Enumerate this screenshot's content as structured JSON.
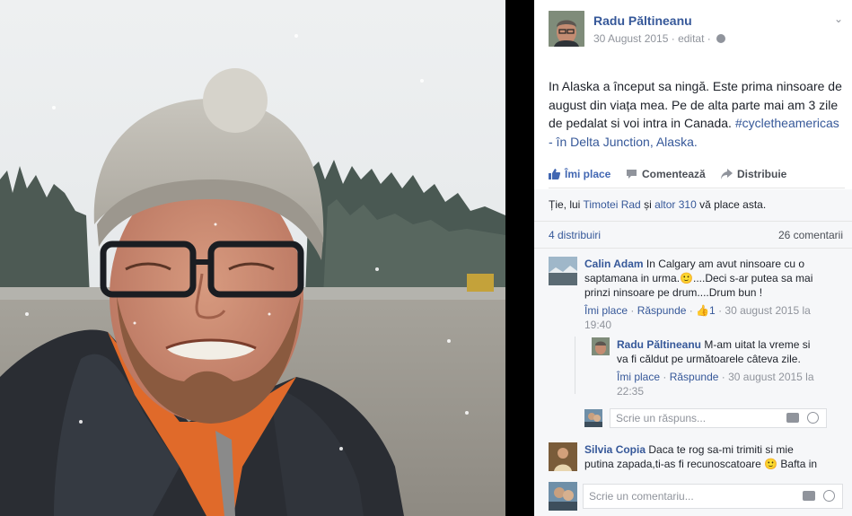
{
  "post": {
    "author": "Radu Păltineanu",
    "meta": "30 August 2015 · editat ·",
    "text_plain": "In Alaska a început sa ningă. Este prima ninsoare de august din viața mea. Pe de alta parte mai am 3 zile de pedalat si voi intra in Canada.",
    "hashtag": "#cycletheamericas",
    "location_prefix": "- în",
    "location": "Delta Junction, Alaska."
  },
  "actions": {
    "like": "Îmi place",
    "comment": "Comentează",
    "share": "Distribuie"
  },
  "likes": {
    "prefix": "Ție, lui",
    "person": "Timotei Rad",
    "and": "și",
    "others": "altor 310",
    "suffix": "vă place asta."
  },
  "counts": {
    "shares": "4 distribuiri",
    "comments": "26 comentarii"
  },
  "comments": [
    {
      "name": "Calin Adam",
      "text": "In Calgary am avut ninsoare cu o saptamana in urma.🙂....Deci s-ar putea sa mai prinzi ninsoare pe drum....Drum bun !",
      "like": "Îmi place",
      "reply": "Răspunde",
      "like_count": "1",
      "time": "30 august 2015 la 19:40",
      "reply_item": {
        "name": "Radu Păltineanu",
        "text": "M-am uitat la vreme si va fi căldut pe următoarele câteva zile.",
        "like": "Îmi place",
        "reply": "Răspunde",
        "time": "30 august 2015 la 22:35"
      }
    },
    {
      "name": "Silvia Copia",
      "text": "Daca te rog sa-mi trimiti si mie putina zapada,ti-as fi recunoscatoare 🙂 Bafta in"
    }
  ],
  "reply_input": {
    "placeholder": "Scrie un răspuns..."
  },
  "comment_input": {
    "placeholder": "Scrie un comentariu..."
  },
  "colors": {
    "link": "#365899",
    "like_active": "#4267b2",
    "muted": "#90949c",
    "panel_bg": "#f6f7f9"
  },
  "icons": [
    "thumbs-up-icon",
    "comment-icon",
    "share-arrow-icon",
    "globe-icon",
    "chevron-down-icon",
    "camera-icon",
    "smiley-icon"
  ]
}
